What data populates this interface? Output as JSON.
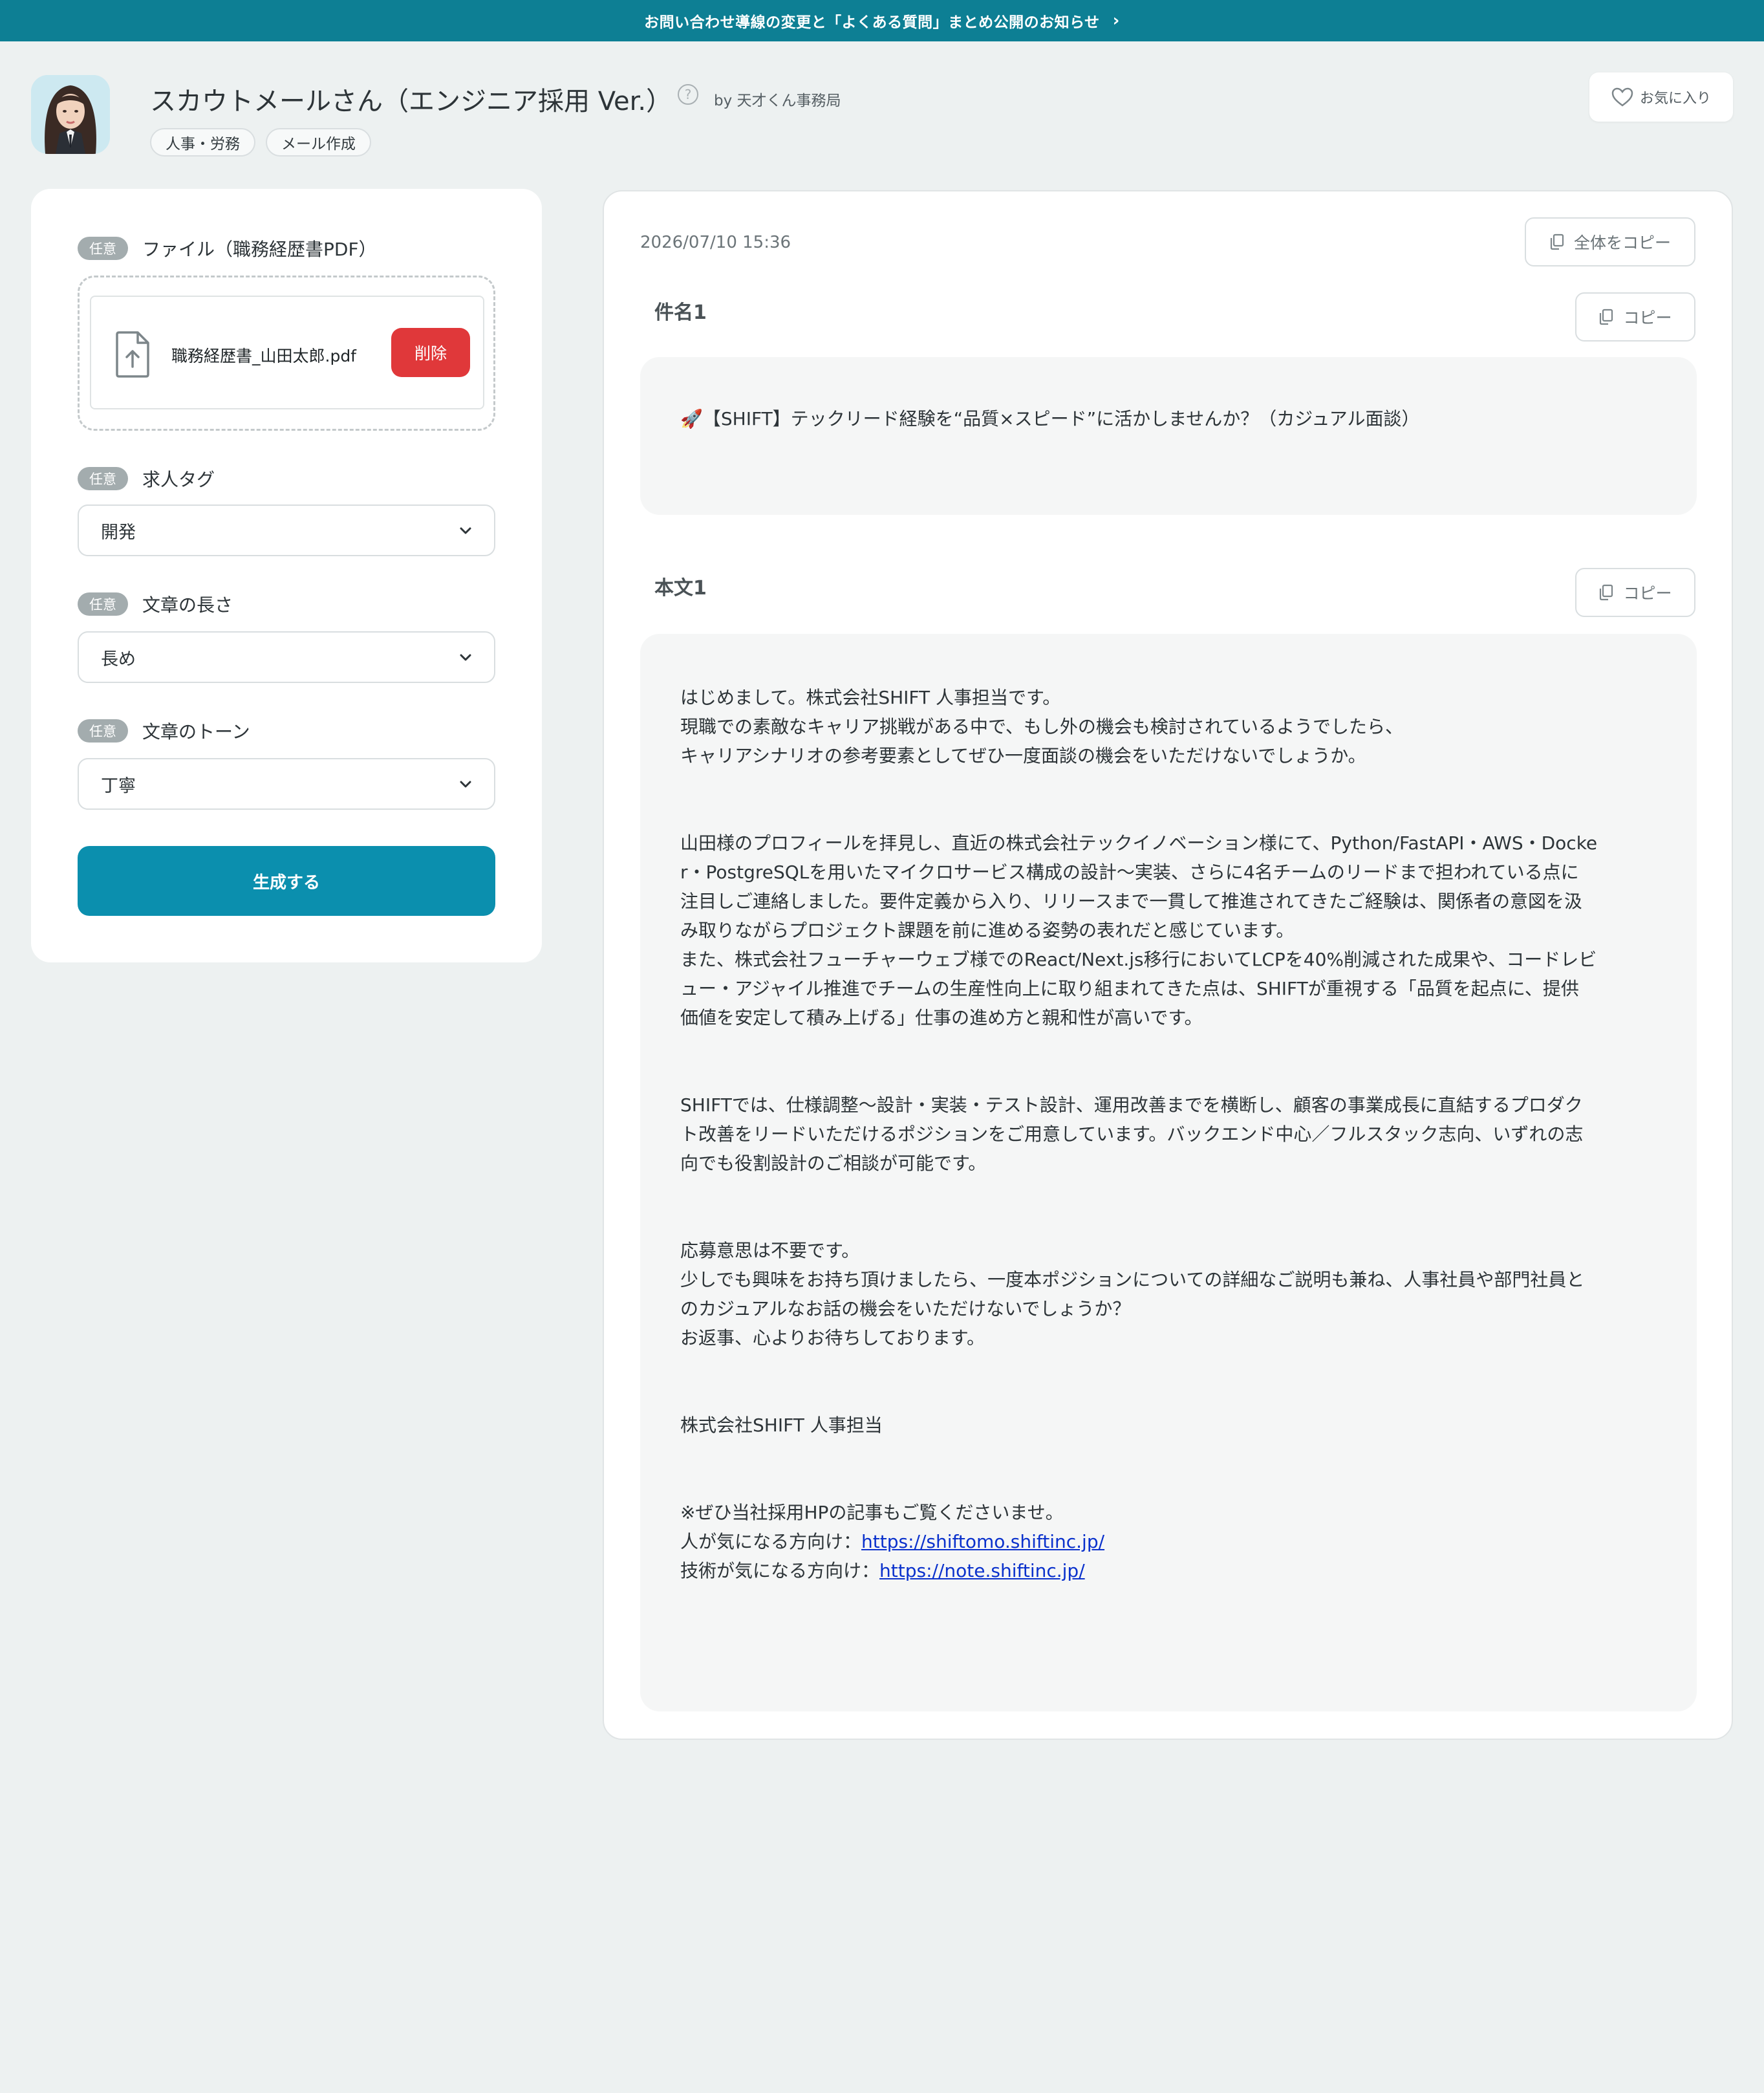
{
  "banner": {
    "text": "お問い合わせ導線の変更と「よくある質問」まとめ公開のお知らせ",
    "chevron": "›"
  },
  "app": {
    "title": "スカウトメールさん（エンジニア採用 Ver.）",
    "help": "?",
    "author": "by 天才くん事務局",
    "tags": [
      "人事・労務",
      "メール作成"
    ],
    "favorite_label": "お気に入り"
  },
  "form": {
    "badge": "任意",
    "file": {
      "label": "ファイル（職務経歴書PDF）",
      "file_name": "職務経歴書_山田太郎.pdf",
      "delete_label": "削除"
    },
    "job_tag": {
      "label": "求人タグ",
      "value": "開発"
    },
    "length": {
      "label": "文章の長さ",
      "value": "長め"
    },
    "tone": {
      "label": "文章のトーン",
      "value": "丁寧"
    },
    "generate_label": "生成する"
  },
  "result": {
    "timestamp": "2026/07/10 15:36",
    "copy_all_label": "全体をコピー",
    "copy_label": "コピー",
    "subject": {
      "title": "件名1",
      "text": "🚀【SHIFT】テックリード経験を“品質×スピード”に活かしませんか？（カジュアル面談）"
    },
    "body": {
      "title": "本文1",
      "paragraphs": [
        "はじめまして。株式会社SHIFT 人事担当です。\n現職での素敵なキャリア挑戦がある中で、もし外の機会も検討されているようでしたら、\nキャリアシナリオの参考要素としてぜひ一度面談の機会をいただけないでしょうか。",
        "山田様のプロフィールを拝見し、直近の株式会社テックイノベーション様にて、Python/FastAPI・AWS・Docke\nr・PostgreSQLを用いたマイクロサービス構成の設計〜実装、さらに4名チームのリードまで担われている点に\n注目しご連絡しました。要件定義から入り、リリースまで一貫して推進されてきたご経験は、関係者の意図を汲\nみ取りながらプロジェクト課題を前に進める姿勢の表れだと感じています。\nまた、株式会社フューチャーウェブ様でのReact/Next.js移行においてLCPを40%削減された成果や、コードレビ\nュー・アジャイル推進でチームの生産性向上に取り組まれてきた点は、SHIFTが重視する「品質を起点に、提供\n価値を安定して積み上げる」仕事の進め方と親和性が高いです。",
        "SHIFTでは、仕様調整〜設計・実装・テスト設計、運用改善までを横断し、顧客の事業成長に直結するプロダク\nト改善をリードいただけるポジションをご用意しています。バックエンド中心／フルスタック志向、いずれの志\n向でも役割設計のご相談が可能です。",
        "応募意思は不要です。\n少しでも興味をお持ち頂けましたら、一度本ポジションについての詳細なご説明も兼ね、人事社員や部門社員と\nのカジュアルなお話の機会をいただけないでしょうか？\nお返事、心よりお待ちしております。",
        "株式会社SHIFT 人事担当"
      ],
      "closing_note": "※ぜひ当社採用HPの記事もご覧くださいませ。",
      "link1_prefix": "人が気になる方向け：",
      "link1_url": "https://shiftomo.shiftinc.jp/",
      "link2_prefix": "技術が気になる方向け：",
      "link2_url": "https://note.shiftinc.jp/"
    }
  },
  "colors": {
    "banner": "#0d7f94",
    "primary_button": "#0b8fae",
    "delete_button": "#e0383a",
    "page_bg": "#edf1f1"
  },
  "icons": [
    "chevron-right-icon",
    "help-icon",
    "heart-icon",
    "file-upload-icon",
    "chevron-down-icon",
    "copy-icon"
  ]
}
